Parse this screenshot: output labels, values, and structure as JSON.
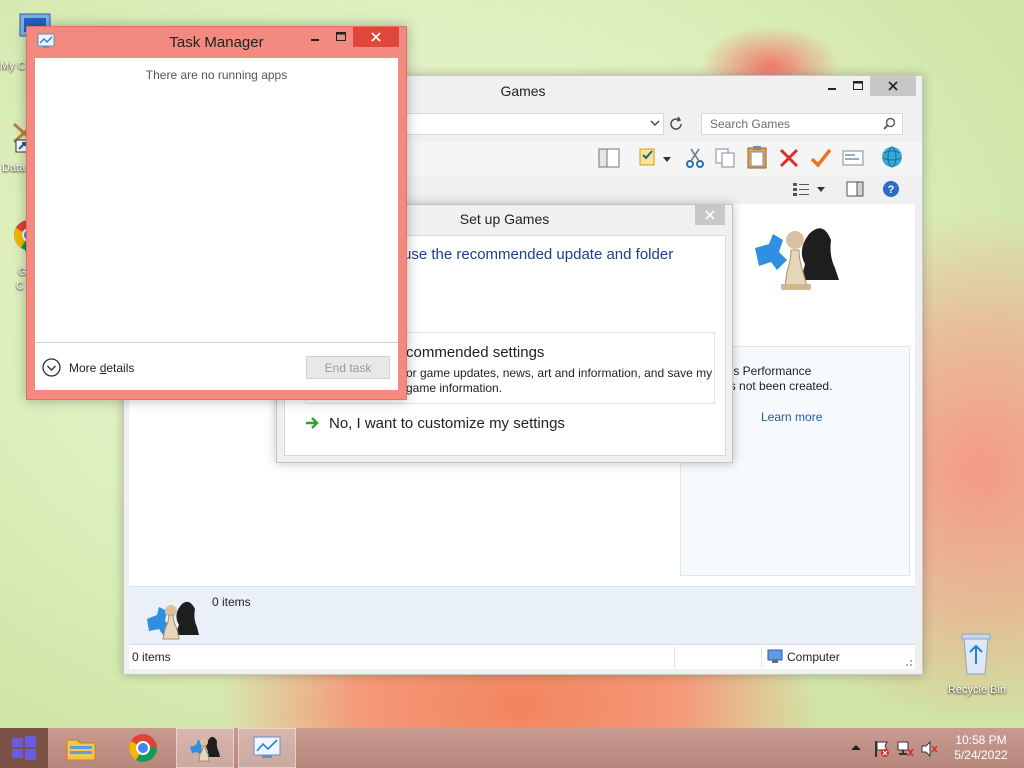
{
  "desktop": {
    "icons": [
      {
        "label": "My C",
        "icon": "computer-icon"
      },
      {
        "label": "Data",
        "icon": "database-shortcut-icon"
      },
      {
        "label": "G",
        "label2": "C",
        "icon": "chrome-shortcut-icon"
      },
      {
        "label": "Recycle Bin",
        "icon": "recycle-bin-icon"
      }
    ]
  },
  "games_window": {
    "title": "Games",
    "search_placeholder": "Search Games",
    "details_count": "0 items",
    "status_items": "0 items",
    "status_location": "Computer",
    "performance_text_line1": "omputer's Performance",
    "performance_text_line2": "ation has not been created.",
    "learn_more": "Learn more"
  },
  "setup_dialog": {
    "title": "Set up Games",
    "heading": "use the recommended update and folder",
    "option1_title": "commended settings",
    "option1_desc_line1": "or game updates, news, art and information, and save my",
    "option1_desc_line2": "game information.",
    "option2_title": "No, I want to customize my settings"
  },
  "task_manager": {
    "title": "Task Manager",
    "empty_message": "There are no running apps",
    "more_details_prefix": "More ",
    "more_details_underlined": "d",
    "more_details_suffix": "etails",
    "end_task": "End task"
  },
  "taskbar": {
    "time": "10:58 PM",
    "date": "5/24/2022",
    "buttons": [
      "start-button",
      "file-explorer",
      "chrome",
      "games",
      "task-manager"
    ]
  },
  "colors": {
    "task_manager_accent": "#f28a7f",
    "link_blue": "#1a5fa8",
    "heading_blue": "#1e3f8a",
    "green_arrow": "#2aa52a"
  }
}
